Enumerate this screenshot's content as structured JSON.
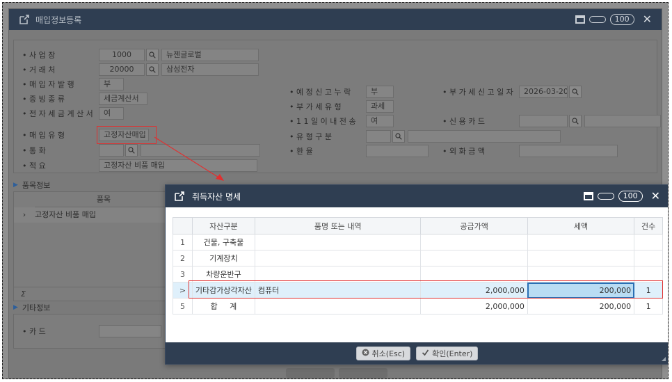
{
  "background_window": {
    "title": "매입정보등록",
    "zoom": "100",
    "close": "✕",
    "fields": [
      {
        "label": "• 사   업   장",
        "value": "1000",
        "extra": "뉴젠글로벌"
      },
      {
        "label": "• 거   래   처",
        "value": "20000",
        "extra": "삼성전자"
      },
      {
        "label": "• 매 입 자 발 행",
        "value": "부"
      },
      {
        "label": "• 증   빙   종   류",
        "value": "세금계산서"
      },
      {
        "label": "• 전 자 세 금 계 산 서",
        "value": "여"
      },
      {
        "label": "• 매   입   유   형",
        "value": "고정자산매입"
      },
      {
        "label": "• 통          화",
        "value": ""
      },
      {
        "label": "• 적          요",
        "value": "고정자산 비품 매입"
      }
    ],
    "fields_mid": [
      {
        "label": "• 예 정 신 고 누 락",
        "value": "부"
      },
      {
        "label": "• 부 가 세 유 형",
        "value": "과세"
      },
      {
        "label": "• 1 1 일 이 내 전 송",
        "value": "여"
      },
      {
        "label": "• 유   형   구   분",
        "value": ""
      },
      {
        "label": "• 환          율",
        "value": ""
      }
    ],
    "fields_right": [
      {
        "label": "• 부 가 세 신 고 일 자",
        "value": "2026-03-20"
      },
      {
        "label": "• 신   용   카   드",
        "value": ""
      },
      {
        "label": "• 외   화   금   액",
        "value": ""
      }
    ],
    "item_section": {
      "title": "품목정보",
      "col_header": "품목",
      "row": "고정자산 비품 매입",
      "footer": "Σ"
    },
    "other_section": {
      "title": "기타정보",
      "field_label": "• 카          드"
    }
  },
  "modal": {
    "title": "취득자산 명세",
    "zoom": "100",
    "close": "✕",
    "columns": [
      "",
      "자산구분",
      "품명 또는 내역",
      "공급가액",
      "세액",
      "건수"
    ],
    "rows": [
      {
        "no": "1",
        "category": "건물, 구축물",
        "desc": "",
        "amount": "",
        "tax": "",
        "count": ""
      },
      {
        "no": "2",
        "category": "기계장치",
        "desc": "",
        "amount": "",
        "tax": "",
        "count": ""
      },
      {
        "no": "3",
        "category": "차량운반구",
        "desc": "",
        "amount": "",
        "tax": "",
        "count": ""
      },
      {
        "no": ">",
        "category": "기타감가상각자산",
        "desc": "컴퓨터",
        "amount": "2,000,000",
        "tax": "200,000",
        "count": "1"
      },
      {
        "no": "5",
        "category": "합     계",
        "desc": "",
        "amount": "2,000,000",
        "tax": "200,000",
        "count": "1"
      }
    ],
    "buttons": {
      "cancel": "취소(Esc)",
      "confirm": "확인(Enter)"
    }
  }
}
